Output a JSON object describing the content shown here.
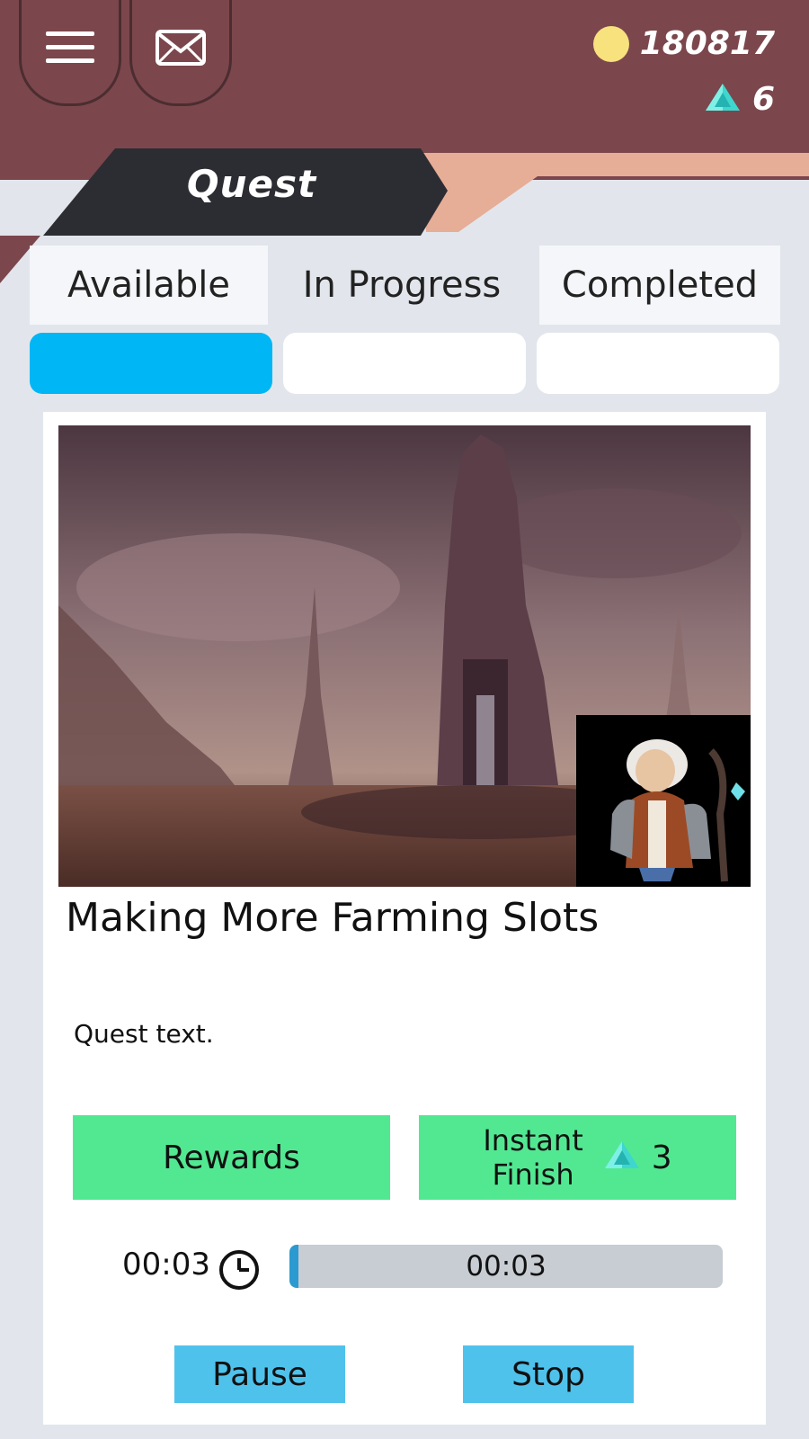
{
  "header": {
    "coins": "180817",
    "gems": "6",
    "title": "Quest",
    "icons": {
      "menu": "hamburger-menu-icon",
      "mail": "envelope-icon",
      "coin": "gold-coin-icon",
      "gem": "diamond-gem-icon"
    }
  },
  "tabs": [
    {
      "label": "Available",
      "active": true
    },
    {
      "label": "In Progress",
      "active": false
    },
    {
      "label": "Completed",
      "active": false
    }
  ],
  "quest": {
    "title": "Making More Farming Slots",
    "text": "Quest text.",
    "rewards_label": "Rewards",
    "instant_finish_line1": "Instant",
    "instant_finish_line2": "Finish",
    "instant_finish_cost": "3",
    "timer": "00:03",
    "progress_label": "00:03",
    "progress_fraction": 0.02,
    "pause_label": "Pause",
    "stop_label": "Stop"
  },
  "colors": {
    "header_bg": "#7b474c",
    "title_banner": "#2c2d33",
    "accent_peach": "#e6ad97",
    "tab_active": "#00b6f4",
    "action_green": "#52e892",
    "action_blue": "#4fc2ec"
  }
}
